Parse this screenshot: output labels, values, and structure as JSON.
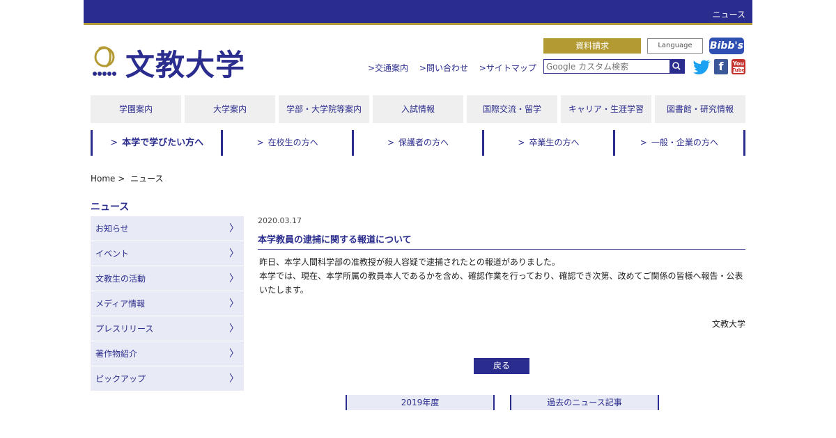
{
  "topbar": {
    "news_link": "ニュース"
  },
  "header": {
    "logo_text": "文教大学",
    "request_button": "資料請求",
    "language_button": "Language",
    "bibbs_label": "Bibb's",
    "util_links": [
      ">交通案内",
      ">問い合わせ",
      ">サイトマップ"
    ],
    "search_placeholder": "Google カスタム検索"
  },
  "global_nav": [
    "学園案内",
    "大学案内",
    "学部・大学院等案内",
    "入試情報",
    "国際交流・留学",
    "キャリア・生涯学習",
    "図書館・研究情報"
  ],
  "target_nav": [
    {
      "label": "本学で学びたい方へ",
      "active": true
    },
    {
      "label": "在校生の方へ",
      "active": false
    },
    {
      "label": "保護者の方へ",
      "active": false
    },
    {
      "label": "卒業生の方へ",
      "active": false
    },
    {
      "label": "一般・企業の方へ",
      "active": false
    }
  ],
  "breadcrumb": {
    "home": "Home >",
    "current": "ニュース"
  },
  "sidebar": {
    "title": "ニュース",
    "items": [
      "お知らせ",
      "イベント",
      "文教生の活動",
      "メディア情報",
      "プレスリリース",
      "著作物紹介",
      "ピックアップ"
    ]
  },
  "article": {
    "date": "2020.03.17",
    "title": "本学教員の逮捕に関する報道について",
    "body_1": "昨日、本学人間科学部の准教授が殺人容疑で逮捕されたとの報道がありました。",
    "body_2": "本学では、現在、本学所属の教員本人であるかを含め、確認作業を行っており、確認でき次第、改めてご関係の皆様へ報告・公表いたします。",
    "signature": "文教大学"
  },
  "back_button": "戻る",
  "bottom_links": [
    "2019年度",
    "過去のニュース記事"
  ],
  "colors": {
    "brand": "#2b2d8e",
    "gold": "#b39a33",
    "side_bg": "#e8eaf6",
    "nav_bg": "#efefef"
  }
}
